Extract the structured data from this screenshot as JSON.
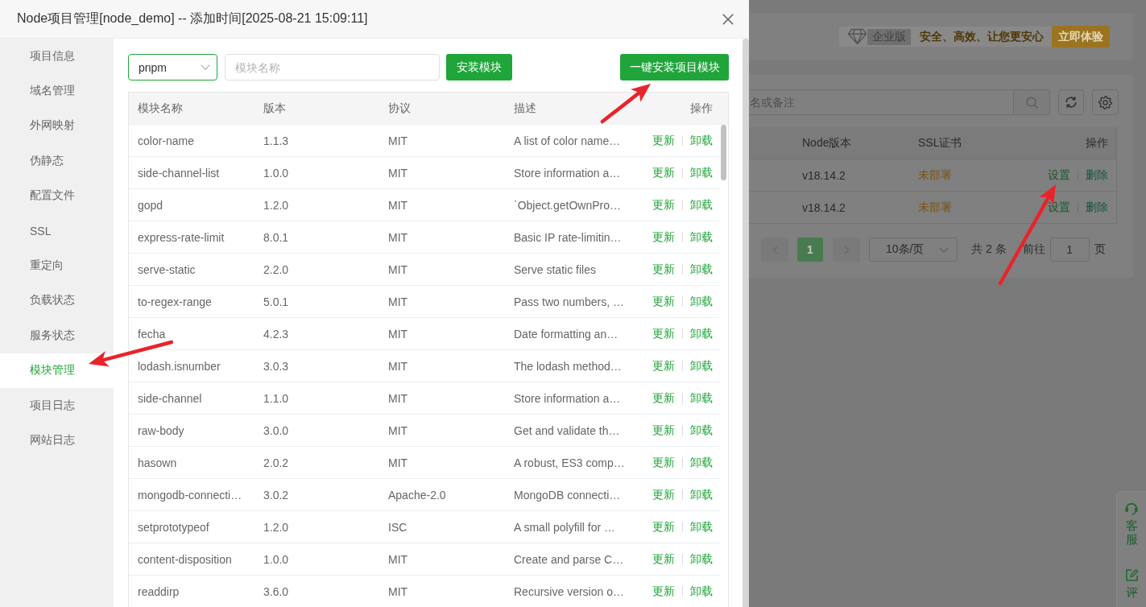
{
  "dialog": {
    "title": "Node项目管理[node_demo] -- 添加时间[2025-08-21 15:09:11]"
  },
  "sidebar": {
    "items": [
      {
        "label": "项目信息",
        "selected": false
      },
      {
        "label": "域名管理",
        "selected": false
      },
      {
        "label": "外网映射",
        "selected": false
      },
      {
        "label": "伪静态",
        "selected": false
      },
      {
        "label": "配置文件",
        "selected": false
      },
      {
        "label": "SSL",
        "selected": false
      },
      {
        "label": "重定向",
        "selected": false
      },
      {
        "label": "负载状态",
        "selected": false
      },
      {
        "label": "服务状态",
        "selected": false
      },
      {
        "label": "模块管理",
        "selected": true
      },
      {
        "label": "项目日志",
        "selected": false
      },
      {
        "label": "网站日志",
        "selected": false
      }
    ]
  },
  "toolbar": {
    "package_manager": {
      "value": "pnpm"
    },
    "module_field": {
      "placeholder": "模块名称"
    },
    "install_button": "安装模块",
    "install_all_button": "一键安装项目模块"
  },
  "module_table": {
    "columns": [
      "模块名称",
      "版本",
      "协议",
      "描述",
      "操作"
    ],
    "rows": [
      {
        "name": "color-name",
        "version": "1.1.3",
        "license": "MIT",
        "description": "A list of color name…",
        "actions": [
          "更新",
          "卸载"
        ]
      },
      {
        "name": "side-channel-list",
        "version": "1.0.0",
        "license": "MIT",
        "description": "Store information a…",
        "actions": [
          "更新",
          "卸载"
        ]
      },
      {
        "name": "gopd",
        "version": "1.2.0",
        "license": "MIT",
        "description": "`Object.getOwnPro…",
        "actions": [
          "更新",
          "卸载"
        ]
      },
      {
        "name": "express-rate-limit",
        "version": "8.0.1",
        "license": "MIT",
        "description": "Basic IP rate-limitin…",
        "actions": [
          "更新",
          "卸载"
        ]
      },
      {
        "name": "serve-static",
        "version": "2.2.0",
        "license": "MIT",
        "description": "Serve static files",
        "actions": [
          "更新",
          "卸载"
        ]
      },
      {
        "name": "to-regex-range",
        "version": "5.0.1",
        "license": "MIT",
        "description": "Pass two numbers, …",
        "actions": [
          "更新",
          "卸载"
        ]
      },
      {
        "name": "fecha",
        "version": "4.2.3",
        "license": "MIT",
        "description": "Date formatting an…",
        "actions": [
          "更新",
          "卸载"
        ]
      },
      {
        "name": "lodash.isnumber",
        "version": "3.0.3",
        "license": "MIT",
        "description": "The lodash method…",
        "actions": [
          "更新",
          "卸载"
        ]
      },
      {
        "name": "side-channel",
        "version": "1.1.0",
        "license": "MIT",
        "description": "Store information a…",
        "actions": [
          "更新",
          "卸载"
        ]
      },
      {
        "name": "raw-body",
        "version": "3.0.0",
        "license": "MIT",
        "description": "Get and validate th…",
        "actions": [
          "更新",
          "卸载"
        ]
      },
      {
        "name": "hasown",
        "version": "2.0.2",
        "license": "MIT",
        "description": "A robust, ES3 comp…",
        "actions": [
          "更新",
          "卸载"
        ]
      },
      {
        "name": "mongodb-connecti…",
        "version": "3.0.2",
        "license": "Apache-2.0",
        "description": "MongoDB connecti…",
        "actions": [
          "更新",
          "卸载"
        ]
      },
      {
        "name": "setprototypeof",
        "version": "1.2.0",
        "license": "ISC",
        "description": "A small polyfill for …",
        "actions": [
          "更新",
          "卸载"
        ]
      },
      {
        "name": "content-disposition",
        "version": "1.0.0",
        "license": "MIT",
        "description": "Create and parse C…",
        "actions": [
          "更新",
          "卸载"
        ]
      },
      {
        "name": "readdirp",
        "version": "3.6.0",
        "license": "MIT",
        "description": "Recursive version o…",
        "actions": [
          "更新",
          "卸载"
        ]
      }
    ]
  },
  "background_page": {
    "banner": {
      "edition_badge": "企业版",
      "slogan": "安全、高效、让您更安心",
      "trial_button": "立即体验"
    },
    "search_field": {
      "placeholder": "名或备注"
    },
    "project_table": {
      "columns": [
        "Node版本",
        "SSL证书",
        "操作"
      ],
      "rows": [
        {
          "node_version": "v18.14.2",
          "ssl": "未部署",
          "actions": [
            "设置",
            "删除"
          ]
        },
        {
          "node_version": "v18.14.2",
          "ssl": "未部署",
          "actions": [
            "设置",
            "删除"
          ]
        }
      ]
    },
    "pagination": {
      "pages": [
        {
          "label": "1",
          "selected": true
        }
      ],
      "page_size": "10条/页",
      "total": "共 2 条",
      "goto_label": "前往",
      "goto_value": "1",
      "page_unit": "页"
    }
  },
  "support_widget": {
    "items": [
      {
        "kind": "headset",
        "label": "客服"
      },
      {
        "kind": "edit",
        "label": "评"
      }
    ]
  },
  "annotations": [
    {
      "kind": "arrow"
    },
    {
      "kind": "arrow"
    },
    {
      "kind": "arrow"
    }
  ]
}
